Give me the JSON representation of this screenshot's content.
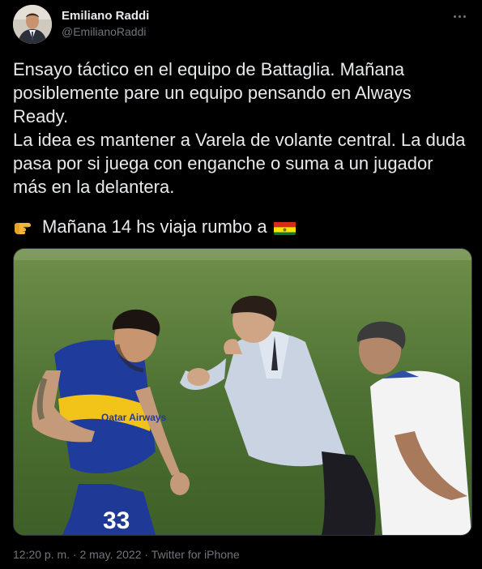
{
  "author": {
    "name": "Emiliano Raddi",
    "handle": "@EmilianoRaddi"
  },
  "tweet": {
    "text": "Ensayo táctico en el equipo de Battaglia. Mañana posiblemente pare un equipo pensando en Always Ready.\nLa idea es mantener a Varela de volante central. La duda pasa por si juega con enganche o suma a un jugador más en la delantera.",
    "line2": "Mañana 14 hs viaja rumbo a",
    "emoji_pointing": "backhand-index-pointing-right-icon",
    "emoji_flag": "bolivia-flag-icon"
  },
  "photo": {
    "jersey_text": "Qatar Airways",
    "jersey_number": "33"
  },
  "meta": {
    "time": "12:20 p. m.",
    "sep1": " · ",
    "date": "2 may. 2022",
    "sep2": " · ",
    "source": "Twitter for iPhone"
  },
  "colors": {
    "background": "#000000",
    "text": "#e7e9ea",
    "secondary": "#71767b",
    "boca_blue": "#1f3b9b",
    "boca_yellow": "#f2c318"
  }
}
